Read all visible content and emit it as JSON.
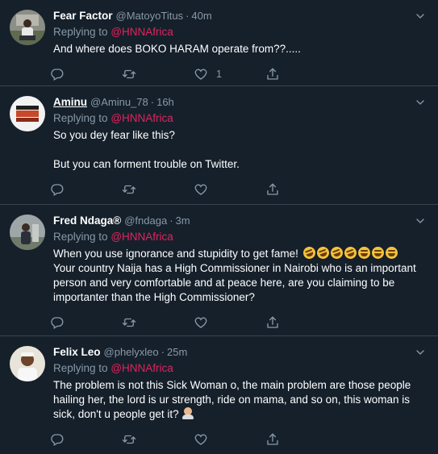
{
  "tweets": [
    {
      "name": "Fear Factor",
      "handle": "@MatoyoTitus",
      "dot": "·",
      "time": "40m",
      "replying_prefix": "Replying to",
      "replying_to": "@HNNAfrica",
      "paragraphs": [
        "And where does BOKO HARAM operate from??....."
      ],
      "like_count": "1"
    },
    {
      "name": "Aminu",
      "handle": "@Aminu_78",
      "dot": "·",
      "time": "16h",
      "replying_prefix": "Replying to",
      "replying_to": "@HNNAfrica",
      "paragraphs": [
        "So you dey fear like this?",
        "But you can forment trouble on Twitter."
      ],
      "like_count": ""
    },
    {
      "name": "Fred Ndaga®",
      "handle": "@fndaga",
      "dot": "·",
      "time": "3m",
      "replying_prefix": "Replying to",
      "replying_to": "@HNNAfrica",
      "paragraphs": [
        "When you use ignorance and stupidity to get fame!",
        "Your country Naija has a High Commissioner in Nairobi who is  an important person and very comfortable and at peace here, are you claiming to be importanter than the High Commissioner?"
      ],
      "like_count": ""
    },
    {
      "name": "Felix Leo",
      "handle": "@phelyxleo",
      "dot": "·",
      "time": "25m",
      "replying_prefix": "Replying to",
      "replying_to": "@HNNAfrica",
      "paragraphs": [
        "The problem is not this Sick Woman o, the main problem are those people hailing her, the lord is ur strength, ride on mama, and so on, this woman is sick, don't u people get it?"
      ],
      "like_count": ""
    }
  ],
  "icons": {
    "reply": "reply-icon",
    "retweet": "retweet-icon",
    "like": "heart-icon",
    "share": "share-icon",
    "more": "chevron-down-icon"
  },
  "colors": {
    "background": "#15202b",
    "divider": "#38444d",
    "secondary_text": "#8899a6",
    "mention": "#e0245e"
  }
}
